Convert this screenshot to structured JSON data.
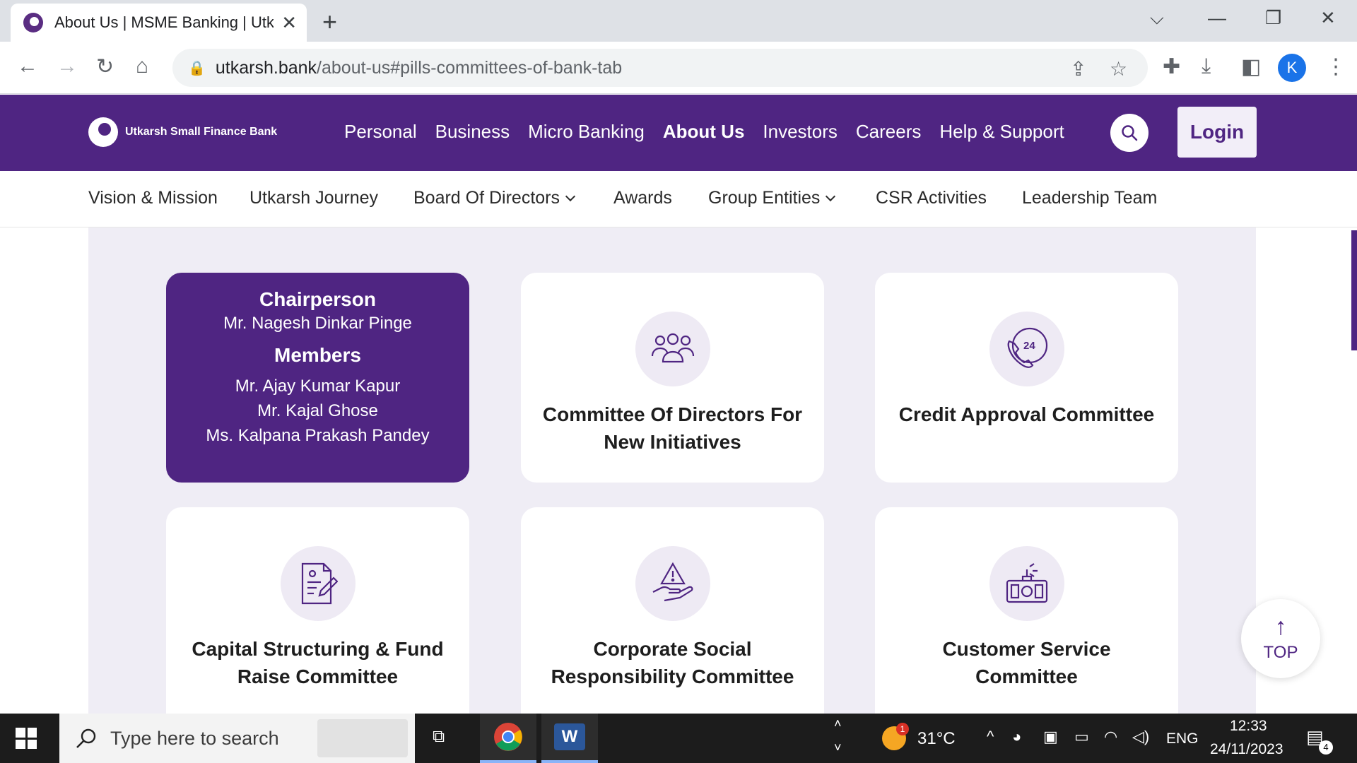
{
  "browser": {
    "tab_title": "About Us | MSME Banking | Utkarsh",
    "url_host": "utkarsh.bank",
    "url_path": "/about-us#pills-committees-of-bank-tab",
    "profile_initial": "K"
  },
  "header": {
    "logo_text": "Utkarsh Small Finance Bank",
    "nav": [
      "Personal",
      "Business",
      "Micro Banking",
      "About Us",
      "Investors",
      "Careers",
      "Help & Support"
    ],
    "active_nav": "About Us",
    "login_label": "Login"
  },
  "sub_nav": {
    "items": [
      "Vision & Mission",
      "Utkarsh Journey",
      "Board Of Directors",
      "Awards",
      "Group Entities",
      "CSR Activities",
      "Leadership Team"
    ]
  },
  "cards": {
    "active": {
      "chair_heading": "Chairperson",
      "chair_name": "Mr. Nagesh Dinkar Pinge",
      "members_heading": "Members",
      "members": [
        "Mr. Ajay Kumar Kapur",
        "Mr. Kajal Ghose",
        "Ms. Kalpana Prakash Pandey"
      ]
    },
    "committees": [
      {
        "title": "Committee Of Directors For New Initiatives",
        "icon": "group-icon"
      },
      {
        "title": "Credit Approval Committee",
        "icon": "phone-24-icon"
      },
      {
        "title": "Capital Structuring & Fund Raise Committee",
        "icon": "document-edit-icon"
      },
      {
        "title": "Corporate Social Responsibility Committee",
        "icon": "hand-alert-icon"
      },
      {
        "title": "Customer Service Committee",
        "icon": "customer-service-icon"
      }
    ]
  },
  "top_button": {
    "label": "TOP"
  },
  "taskbar": {
    "search_placeholder": "Type here to search",
    "weather": "31°C",
    "weather_badge": "1",
    "language": "ENG",
    "time": "12:33",
    "date": "24/11/2023",
    "notifications": "4"
  },
  "colors": {
    "brand": "#4f2582",
    "panel": "#efedf5"
  }
}
